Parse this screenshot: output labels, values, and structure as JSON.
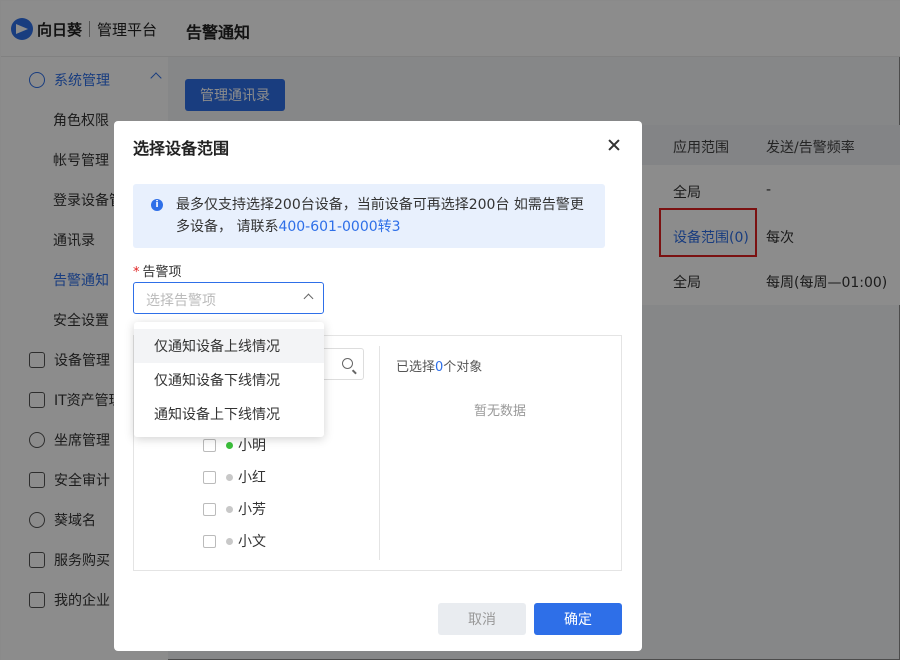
{
  "app": {
    "brand": "向日葵",
    "subtitle": "管理平台",
    "page_title": "告警通知"
  },
  "sidebar": {
    "groups": [
      {
        "label": "系统管理",
        "icon": "gear-icon",
        "expanded": true,
        "children": [
          "角色权限",
          "帐号管理",
          "登录设备管理",
          "通讯录",
          "告警通知",
          "安全设置"
        ]
      },
      {
        "label": "设备管理",
        "icon": "monitor-icon"
      },
      {
        "label": "IT资产管理",
        "icon": "chip-icon"
      },
      {
        "label": "坐席管理",
        "icon": "headset-icon"
      },
      {
        "label": "安全审计",
        "icon": "document-icon"
      },
      {
        "label": "葵域名",
        "icon": "globe-icon"
      },
      {
        "label": "服务购买",
        "icon": "bag-icon"
      },
      {
        "label": "我的企业",
        "icon": "building-icon"
      }
    ],
    "active_child": "告警通知"
  },
  "main": {
    "manage_contacts_button": "管理通讯录",
    "table": {
      "headers": [
        "应用范围",
        "发送/告警频率"
      ],
      "rows": [
        {
          "scope": "全局",
          "frequency": "-"
        },
        {
          "scope": "设备范围(0)",
          "frequency": "每次"
        },
        {
          "scope": "全局",
          "frequency": "每周(每周—01:00)"
        }
      ]
    }
  },
  "modal": {
    "title": "选择设备范围",
    "notice": {
      "text": "最多仅支持选择200台设备，当前设备可再选择200台 如需告警更多设备， 请联系",
      "phone": "400-601-0000转3"
    },
    "field": {
      "required_mark": "*",
      "label": "告警项",
      "placeholder": "选择告警项"
    },
    "dropdown_options": [
      "仅通知设备上线情况",
      "仅通知设备下线情况",
      "通知设备上下线情况"
    ],
    "transfer": {
      "selected_prefix": "已选择",
      "selected_count": "0",
      "selected_suffix": "个对象",
      "empty_text": "暂无数据",
      "users": [
        {
          "name": "小明",
          "online": true
        },
        {
          "name": "小红",
          "online": false
        },
        {
          "name": "小芳",
          "online": false
        },
        {
          "name": "小文",
          "online": false
        }
      ]
    },
    "cancel_label": "取消",
    "ok_label": "确定"
  },
  "colors": {
    "primary": "#2e6fe8",
    "highlight_border": "#e02020",
    "online": "#3bbf3b"
  }
}
